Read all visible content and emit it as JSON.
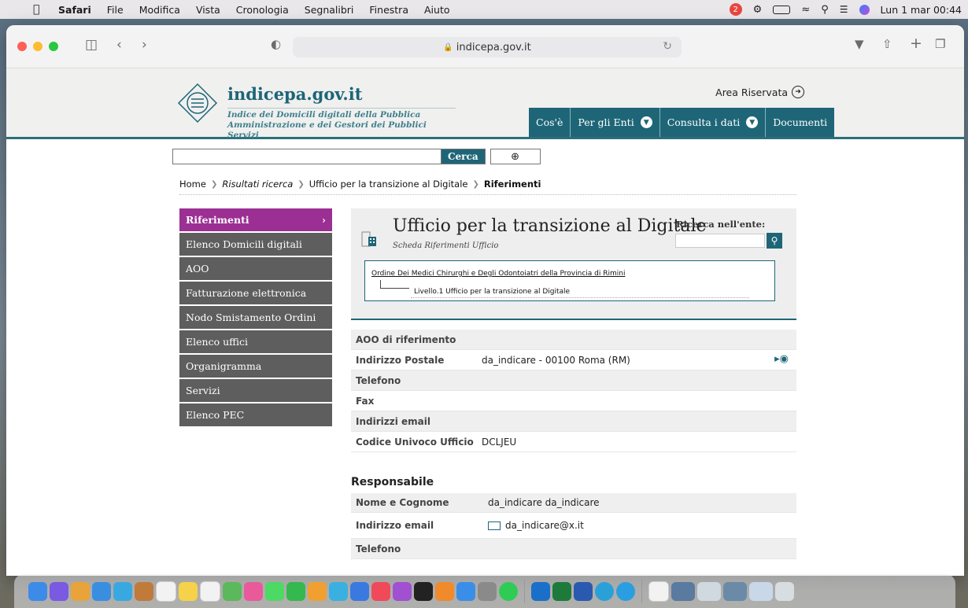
{
  "menubar": {
    "app_name": "Safari",
    "items": [
      "File",
      "Modifica",
      "Vista",
      "Cronologia",
      "Segnalibri",
      "Finestra",
      "Aiuto"
    ],
    "notification_count": "2",
    "clock": "Lun 1 mar  00:44"
  },
  "browser": {
    "url": "indicepa.gov.it"
  },
  "site": {
    "logo_title": "indicepa.gov.it",
    "logo_sub_line1": "Indice dei Domicili digitali della Pubblica",
    "logo_sub_line2": "Amministrazione e dei Gestori dei Pubblici Servizi",
    "area_riservata": "Area Riservata",
    "nav": [
      "Cos'è",
      "Per gli Enti",
      "Consulta i dati",
      "Documenti"
    ],
    "search_button": "Cerca",
    "search_value": ""
  },
  "breadcrumb": {
    "items": [
      "Home",
      "Risultati ricerca",
      "Ufficio per la transizione al Digitale",
      "Riferimenti"
    ]
  },
  "sidemenu": {
    "items": [
      "Riferimenti",
      "Elenco Domicili digitali",
      "AOO",
      "Fatturazione elettronica",
      "Nodo Smistamento Ordini",
      "Elenco uffici",
      "Organigramma",
      "Servizi",
      "Elenco PEC"
    ]
  },
  "card": {
    "title": "Ufficio per la transizione al Digitale",
    "subtitle": "Scheda Riferimenti Ufficio",
    "search_label": "Ricerca nell'ente:",
    "tree_parent": "Ordine Dei Medici Chirurghi e Degli Odontoiatri della Provincia di Rimini",
    "tree_child": "Livello.1 Ufficio per la transizione al Digitale"
  },
  "details": [
    {
      "label": "AOO di riferimento",
      "value": ""
    },
    {
      "label": "Indirizzo Postale",
      "value": "da_indicare - 00100 Roma (RM)"
    },
    {
      "label": "Telefono",
      "value": ""
    },
    {
      "label": "Fax",
      "value": ""
    },
    {
      "label": "Indirizzi email",
      "value": ""
    },
    {
      "label": "Codice Univoco Ufficio",
      "value": "DCLJEU"
    }
  ],
  "responsabile": {
    "heading": "Responsabile",
    "rows": [
      {
        "label": "Nome e Cognome",
        "value": "da_indicare da_indicare"
      },
      {
        "label": "Indirizzo email",
        "value": "da_indicare@x.it"
      },
      {
        "label": "Telefono",
        "value": ""
      }
    ]
  },
  "colors": {
    "teal": "#1e6677",
    "active_menu": "#9b2f93",
    "side_menu": "#5e5e5e"
  }
}
